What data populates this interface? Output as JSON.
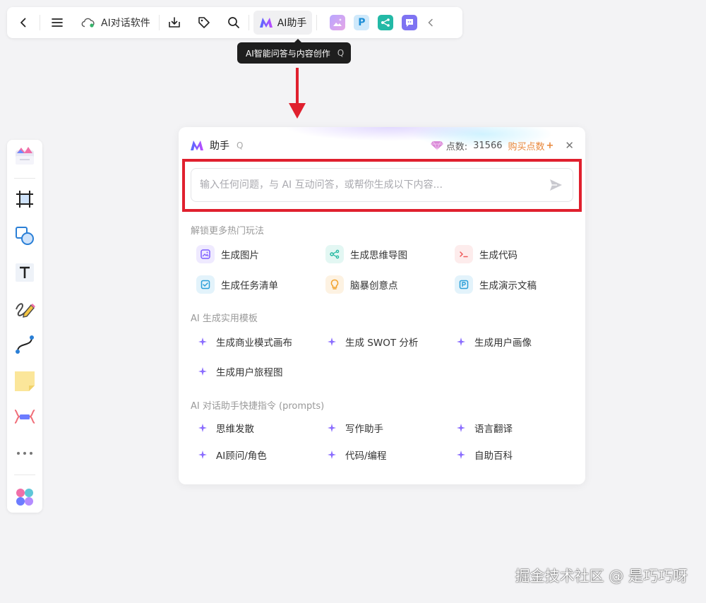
{
  "toolbar": {
    "doc_title": "AI对话软件",
    "ai_button_label": "AI助手",
    "tooltip": {
      "text": "AI智能问答与内容创作",
      "shortcut": "Q"
    }
  },
  "panel": {
    "title": "助手",
    "shortcut": "Q",
    "points_label": "点数:",
    "points_value": "31566",
    "buy_label": "购买点数",
    "buy_plus": "+",
    "close": "✕",
    "input_placeholder": "输入任何问题，与 AI 互动问答，或帮你生成以下内容...",
    "sections": [
      {
        "title": "解锁更多热门玩法",
        "items": [
          {
            "label": "生成图片",
            "icon": "image-icon",
            "color": "#7c5cff",
            "bg": "#efeaff"
          },
          {
            "label": "生成思维导图",
            "icon": "mindmap-icon",
            "color": "#21b8a0",
            "bg": "#e3f7f3"
          },
          {
            "label": "生成代码",
            "icon": "code-icon",
            "color": "#ef5a5a",
            "bg": "#fdecec"
          },
          {
            "label": "生成任务清单",
            "icon": "checklist-icon",
            "color": "#2a9ed8",
            "bg": "#e3f3fb"
          },
          {
            "label": "脑暴创意点",
            "icon": "lightbulb-icon",
            "color": "#f2a12a",
            "bg": "#fdf2e2"
          },
          {
            "label": "生成演示文稿",
            "icon": "presentation-icon",
            "color": "#2a9ed8",
            "bg": "#e3f3fb"
          }
        ]
      },
      {
        "title": "AI 生成实用模板",
        "items": [
          {
            "label": "生成商业模式画布"
          },
          {
            "label": "生成 SWOT 分析"
          },
          {
            "label": "生成用户画像"
          },
          {
            "label": "生成用户旅程图"
          }
        ]
      },
      {
        "title": "AI 对话助手快捷指令 (prompts)",
        "items": [
          {
            "label": "思维发散"
          },
          {
            "label": "写作助手"
          },
          {
            "label": "语言翻译"
          },
          {
            "label": "AI顾问/角色"
          },
          {
            "label": "代码/编程"
          },
          {
            "label": "自助百科"
          }
        ]
      }
    ]
  },
  "watermark": "掘金技术社区 @ 是巧巧呀",
  "colors": {
    "accent_red": "#e0202e",
    "buy_orange": "#e8873a",
    "spark": "#8a6cff"
  }
}
